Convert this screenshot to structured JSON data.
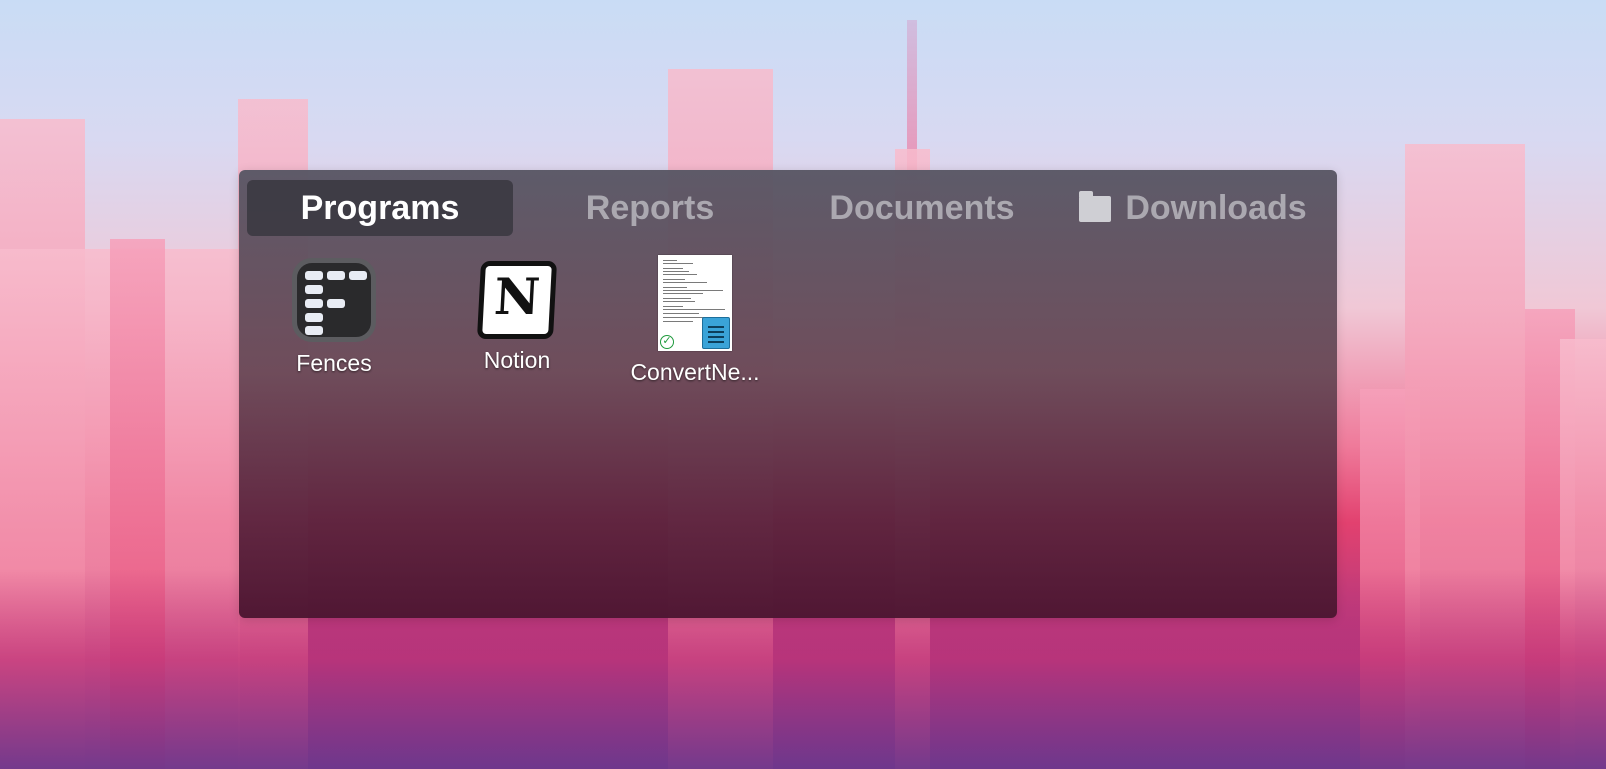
{
  "fence": {
    "tabs": [
      {
        "label": "Programs",
        "active": true
      },
      {
        "label": "Reports",
        "active": false
      },
      {
        "label": "Documents",
        "active": false
      },
      {
        "label": "Downloads",
        "active": false,
        "icon": "folder-icon"
      }
    ],
    "items": [
      {
        "label": "Fences",
        "icon": "fences-app-icon"
      },
      {
        "label": "Notion",
        "icon": "notion-app-icon"
      },
      {
        "label": "ConvertNe...",
        "icon": "text-document-thumbnail-icon"
      }
    ]
  },
  "colors": {
    "active_tab_bg": "#3c3a42",
    "inactive_tab_text": "#c8c8cd",
    "item_label_text": "#ffffff"
  }
}
